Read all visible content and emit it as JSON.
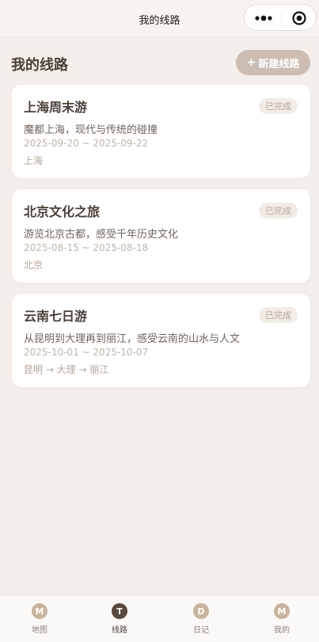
{
  "navbar": {
    "title": "我的线路"
  },
  "header": {
    "title": "我的线路",
    "new_button_plus": "+",
    "new_button_label": "新建线路"
  },
  "routes": [
    {
      "title": "上海周末游",
      "status": "已完成",
      "description": "魔都上海，现代与传统的碰撞",
      "dates": "2025-09-20 ~ 2025-09-22",
      "places": "上海"
    },
    {
      "title": "北京文化之旅",
      "status": "已完成",
      "description": "游览北京古都，感受千年历史文化",
      "dates": "2025-08-15 ~ 2025-08-18",
      "places": "北京"
    },
    {
      "title": "云南七日游",
      "status": "已完成",
      "description": "从昆明到大理再到丽江，感受云南的山水与人文",
      "dates": "2025-10-01 ~ 2025-10-07",
      "places": "昆明 → 大理 → 丽江"
    }
  ],
  "tabbar": {
    "tabs": [
      {
        "icon_letter": "M",
        "label": "地图",
        "icon": "map-icon",
        "active": false
      },
      {
        "icon_letter": "T",
        "label": "线路",
        "icon": "route-icon",
        "active": true
      },
      {
        "icon_letter": "D",
        "label": "日记",
        "icon": "diary-icon",
        "active": false
      },
      {
        "icon_letter": "M",
        "label": "我的",
        "icon": "profile-icon",
        "active": false
      }
    ]
  },
  "colors": {
    "background": "#f4efeb",
    "accent_button": "#cbbdb1",
    "tab_icon": "#c9b49b",
    "tab_icon_active": "#5a4a3d",
    "badge_bg": "#f2ece7"
  }
}
